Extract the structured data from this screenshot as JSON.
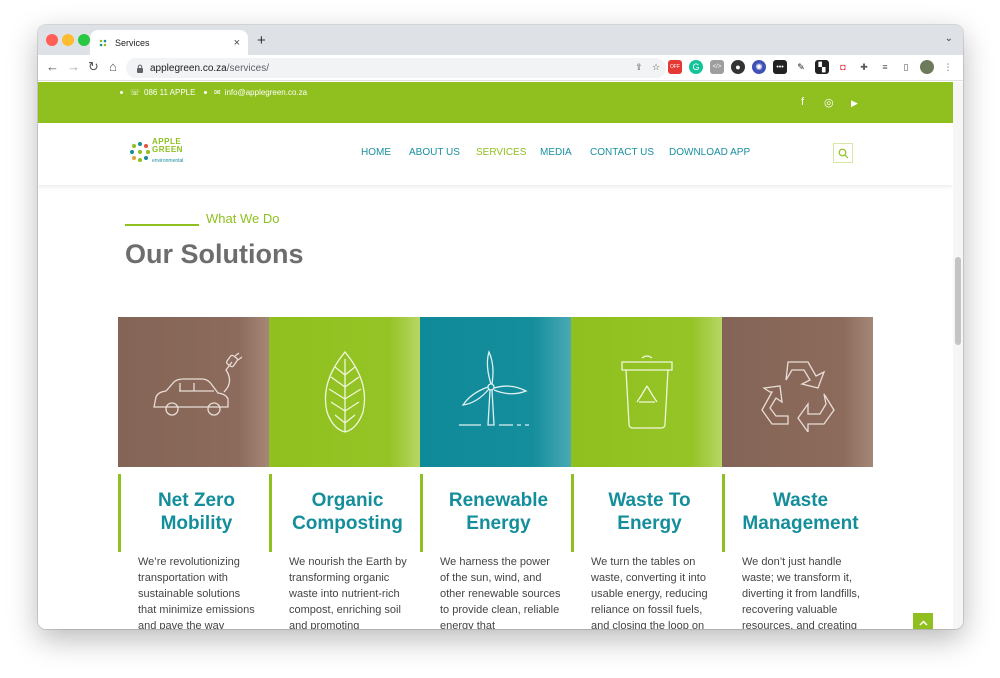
{
  "browser": {
    "tab_title": "Services",
    "tab_close": "×",
    "new_tab": "+",
    "tabstrip_menu": "⌄",
    "url_host": "applegreen.co.za",
    "url_path": "/services/"
  },
  "topbar": {
    "phone": "086 11 APPLE",
    "email": "info@applegreen.co.za",
    "social": [
      "f",
      "◎",
      "▶"
    ]
  },
  "logo": {
    "line1": "APPLE",
    "line2": "GREEN",
    "sub": "environmental"
  },
  "nav": {
    "items": [
      "HOME",
      "ABOUT US",
      "SERVICES",
      "MEDIA",
      "CONTACT US",
      "DOWNLOAD APP"
    ],
    "active": "SERVICES"
  },
  "section": {
    "eyebrow": "What We Do",
    "title": "Our Solutions"
  },
  "cards": [
    {
      "title": "Net Zero Mobility",
      "body": "We’re revolutionizing transportation with sustainable solutions that minimize emissions and pave the way",
      "icon": "electric-car-icon",
      "color": "#8c6b5c"
    },
    {
      "title": "Organic Composting",
      "body": "We nourish the Earth by transforming organic waste into nutrient-rich compost, enriching soil and promoting",
      "icon": "leaf-icon",
      "color": "#8fc01f"
    },
    {
      "title": "Renewable Energy",
      "body": "We harness the power of the sun, wind, and other renewable sources to provide clean, reliable energy that",
      "icon": "wind-turbine-icon",
      "color": "#158e9c"
    },
    {
      "title": "Waste To Energy",
      "body": "We turn the tables on waste, converting it into usable energy, reducing reliance on fossil fuels, and closing the loop on",
      "icon": "recycle-bin-icon",
      "color": "#8fc01f"
    },
    {
      "title": "Waste Management",
      "body": "We don’t just handle waste; we transform it, diverting it from landfills, recovering valuable resources, and creating a",
      "icon": "recycle-icon",
      "color": "#8c6b5c"
    }
  ],
  "colors": {
    "brand_green": "#8fc01f",
    "brand_teal": "#158e9c",
    "brand_brown": "#8c6b5c"
  }
}
